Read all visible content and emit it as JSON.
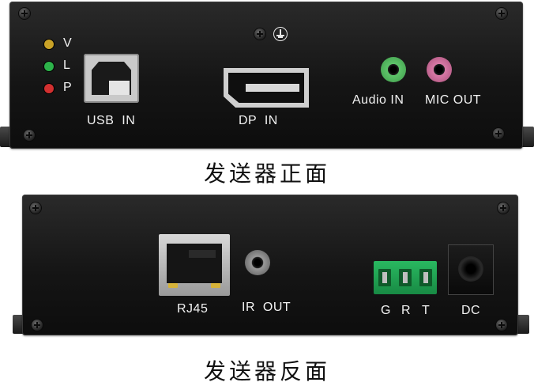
{
  "front": {
    "caption": "发送器正面",
    "led_labels": [
      "V",
      "L",
      "P"
    ],
    "led_colors": [
      "#c9a227",
      "#2db34a",
      "#d23030"
    ],
    "usb_label": "USB  IN",
    "dp_label": "DP  IN",
    "audio_label": "Audio IN",
    "mic_label": "MIC OUT",
    "audio_jack_color": "#5ec46a",
    "mic_jack_color": "#d97aa6"
  },
  "back": {
    "caption": "发送器反面",
    "rj45_label": "RJ45",
    "ir_label": "IR  OUT",
    "terminal_labels": [
      "G",
      "R",
      "T"
    ],
    "dc_label": "DC",
    "terminal_color": "#22a455"
  }
}
